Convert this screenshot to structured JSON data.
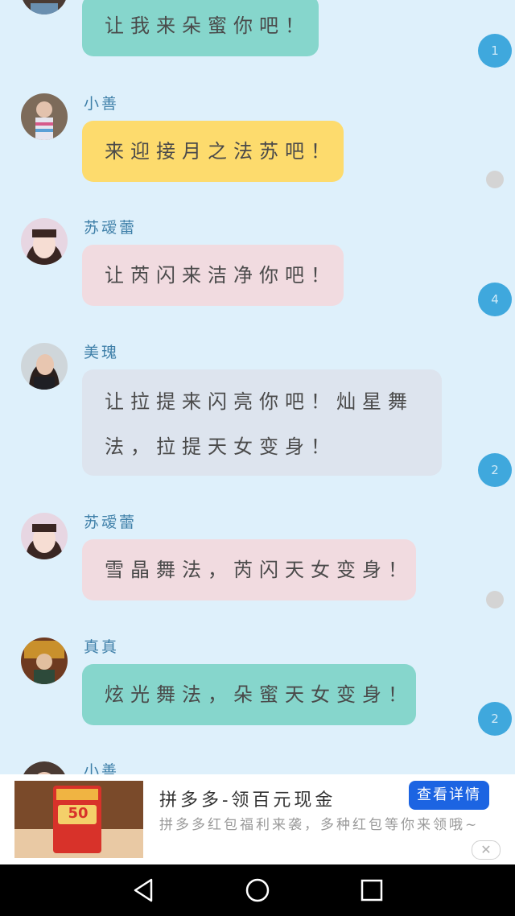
{
  "messages": [
    {
      "sender": "",
      "text": "让我来朵蜜你吧！",
      "bubble_color": "#86d6cc",
      "badge": "1",
      "avatar": "girl"
    },
    {
      "sender": "小善",
      "text": "来迎接月之法苏吧！",
      "bubble_color": "#fddb6d",
      "badge": "",
      "avatar": "girl-striped"
    },
    {
      "sender": "苏叆蕾",
      "text": "让芮闪来洁净你吧！",
      "bubble_color": "#f1dbe0",
      "badge": "4",
      "avatar": "girl-bangs"
    },
    {
      "sender": "美瑰",
      "text_lines": [
        "让拉提来闪亮你吧！灿星舞",
        "法，拉提天女变身！"
      ],
      "bubble_color": "#dde4ee",
      "badge": "2",
      "avatar": "girl-dark"
    },
    {
      "sender": "苏叆蕾",
      "text": "雪晶舞法，芮闪天女变身！",
      "bubble_color": "#f1dbe0",
      "badge": "",
      "avatar": "girl-bangs"
    },
    {
      "sender": "真真",
      "text": "炫光舞法，朵蜜天女变身！",
      "bubble_color": "#86d6cc",
      "badge": "2",
      "avatar": "girl-stage"
    },
    {
      "sender": "小善",
      "text": "",
      "bubble_color": "",
      "badge": "",
      "avatar": "girl"
    }
  ],
  "ad": {
    "title": "拼多多-领百元现金",
    "button": "查看详情",
    "description": "拼多多红包福利来袭，多种红包等你来领哦~",
    "image_badge": "50",
    "close_icon": "close-icon"
  },
  "navbar": {
    "icons": [
      "back-icon",
      "home-icon",
      "recents-icon"
    ]
  },
  "colors": {
    "background": "#def0fb",
    "badge": "#3fa8dd",
    "name": "#3e7fa8",
    "ad_button": "#1c64e2"
  }
}
